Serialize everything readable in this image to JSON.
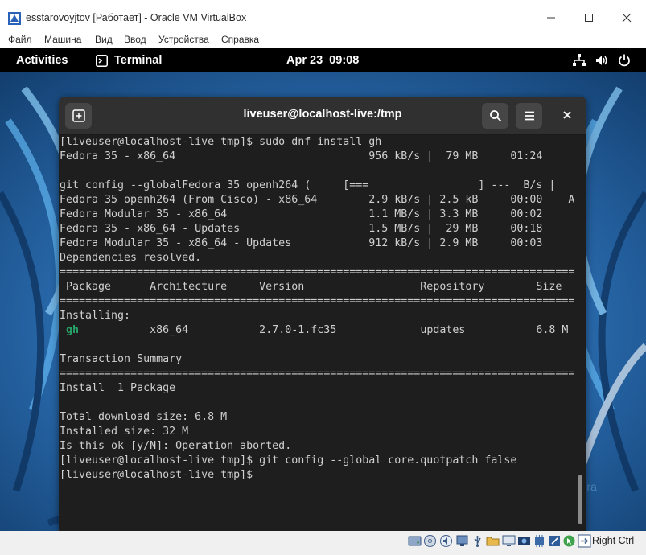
{
  "host_window": {
    "title": "esstarovoyjtov [Работает] - Oracle VM VirtualBox",
    "menu": [
      "Файл",
      "Машина",
      "Вид",
      "Ввод",
      "Устройства",
      "Справка"
    ],
    "host_key": "Right Ctrl"
  },
  "gnome_topbar": {
    "activities": "Activities",
    "app_name": "Terminal",
    "clock": "Apr 23  09:08"
  },
  "terminal": {
    "title": "liveuser@localhost-live:/tmp",
    "lines": [
      "[liveuser@localhost-live tmp]$ sudo dnf install gh",
      "Fedora 35 - x86_64                              956 kB/s |  79 MB     01:24",
      "",
      "git config --globalFedora 35 openh264 (     [===                 ] ---  B/s |",
      "Fedora 35 openh264 (From Cisco) - x86_64        2.9 kB/s | 2.5 kB     00:00    A",
      "Fedora Modular 35 - x86_64                      1.1 MB/s | 3.3 MB     00:02",
      "Fedora 35 - x86_64 - Updates                    1.5 MB/s |  29 MB     00:18",
      "Fedora Modular 35 - x86_64 - Updates            912 kB/s | 2.9 MB     00:03",
      "Dependencies resolved.",
      "================================================================================",
      " Package      Architecture     Version                  Repository        Size",
      "================================================================================",
      "Installing:",
      "gh",
      "",
      "Transaction Summary",
      "================================================================================",
      "Install  1 Package",
      "",
      "Total download size: 6.8 M",
      "Installed size: 32 M",
      "Is this ok [y/N]: Operation aborted.",
      "[liveuser@localhost-live tmp]$ git config --global core.quotpatch false",
      "[liveuser@localhost-live tmp]$ "
    ],
    "package_row": {
      "name": "gh",
      "rest": "           x86_64           2.7.0-1.fc35             updates           6.8 M"
    }
  },
  "colors": {
    "terminal_bg": "#1e1e1e",
    "header_bg": "#303030",
    "package_name_green": "#26a269",
    "topbar_bg": "#000000"
  }
}
